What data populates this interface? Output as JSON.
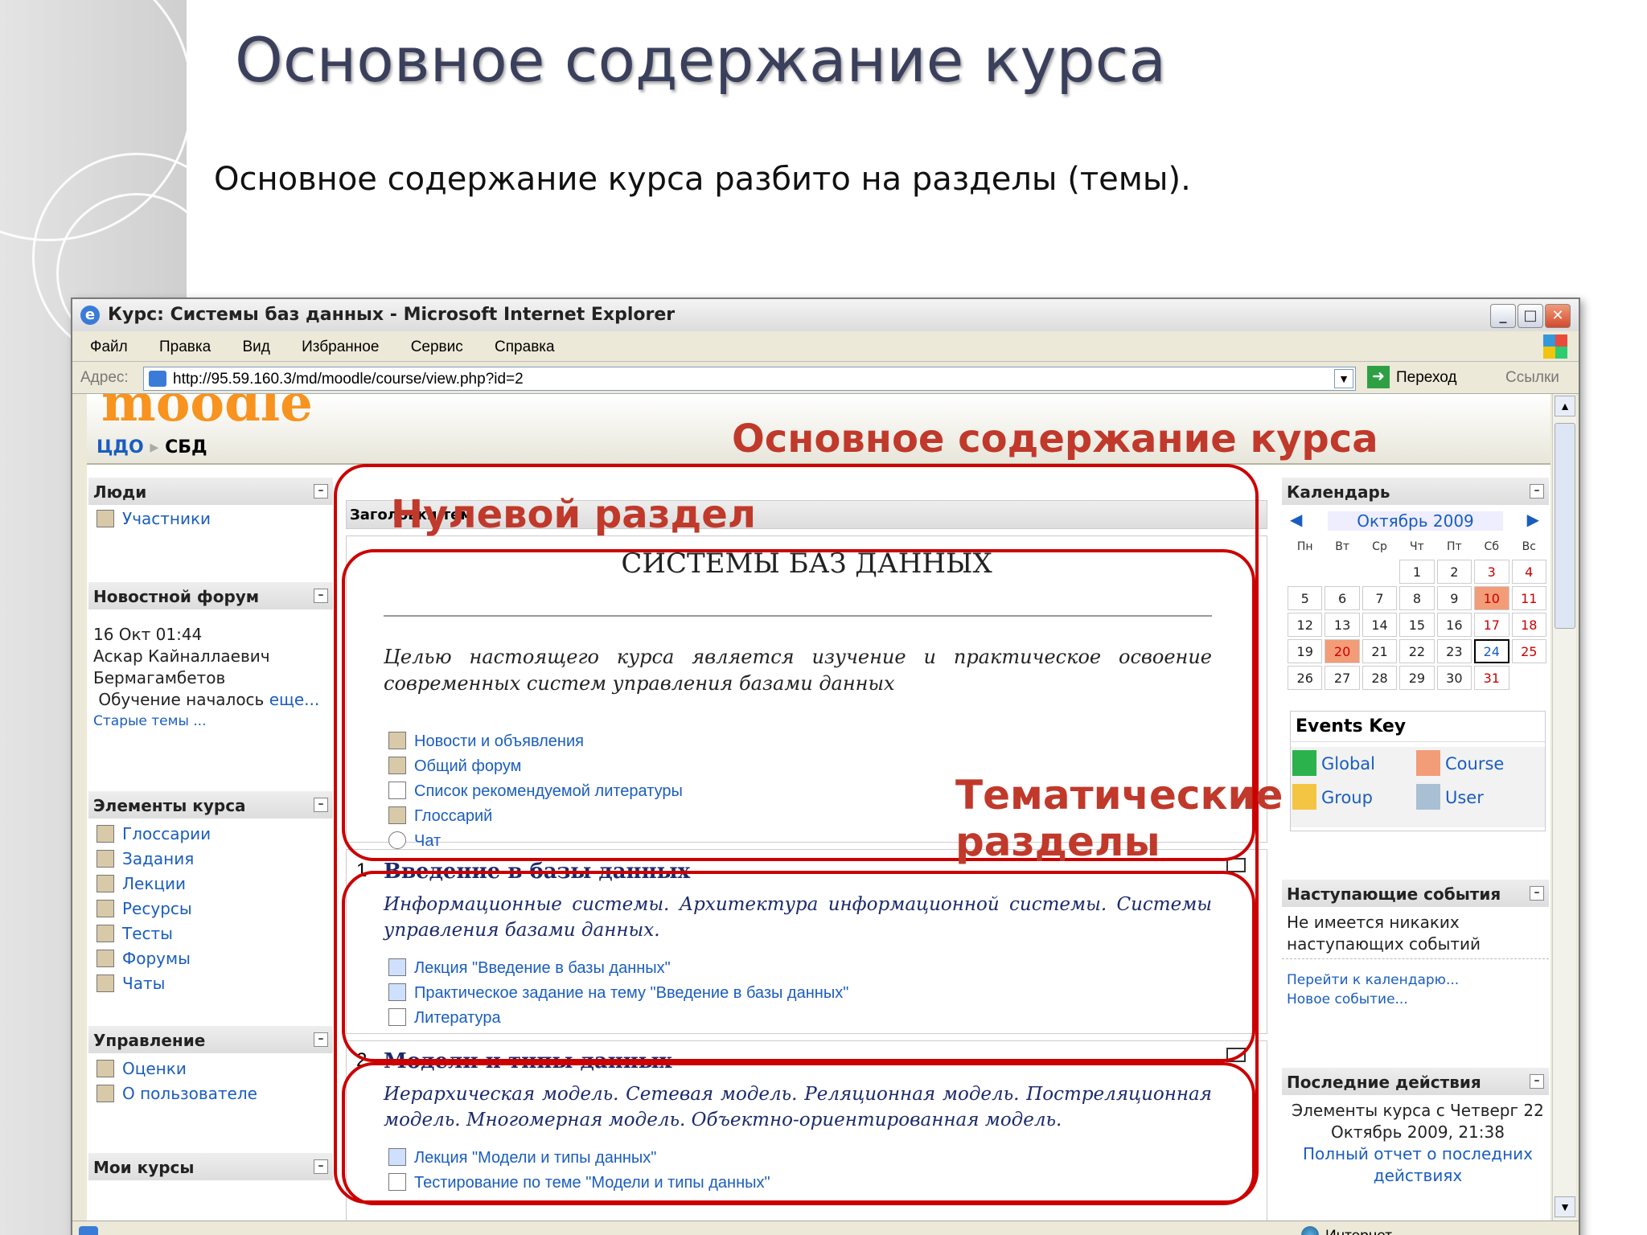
{
  "slide": {
    "title": "Основное содержание курса",
    "subtitle": "Основное содержание курса разбито на разделы (темы)."
  },
  "browser": {
    "title": "Курс: Системы баз данных - Microsoft Internet Explorer",
    "menu": [
      "Файл",
      "Правка",
      "Вид",
      "Избранное",
      "Сервис",
      "Справка"
    ],
    "address_label": "Адрес:",
    "url": "http://95.59.160.3/md/moodle/course/view.php?id=2",
    "go": "Переход",
    "links": "Ссылки",
    "status_zone": "Интернет"
  },
  "moodle": {
    "logo": "moodle",
    "crumb_home": "ЦДО",
    "crumb_course": "СБД"
  },
  "left": {
    "people": {
      "title": "Люди",
      "participants": "Участники"
    },
    "news": {
      "title": "Новостной форум",
      "date": "16 Окт 01:44",
      "author1": "Аскар Кайналлаевич",
      "author2": "Бермагамбетов",
      "msg": "Обучение началось",
      "more": "еще...",
      "old": "Старые темы ..."
    },
    "elements": {
      "title": "Элементы курса",
      "items": [
        "Глоссарии",
        "Задания",
        "Лекции",
        "Ресурсы",
        "Тесты",
        "Форумы",
        "Чаты"
      ]
    },
    "admin": {
      "title": "Управление",
      "items": [
        "Оценки",
        "О пользователе"
      ]
    },
    "my": {
      "title": "Мои курсы"
    }
  },
  "center": {
    "topic_header": "Заголовки тем",
    "course_title": "СИСТЕМЫ БАЗ ДАННЫХ",
    "course_desc": "Целью настоящего курса является изучение и практическое освоение современных систем управления базами данных",
    "zero_links": [
      "Новости и объявления",
      "Общий форум",
      "Список рекомендуемой литературы",
      "Глоссарий",
      "Чат"
    ],
    "s1": {
      "num": "1",
      "title": "Введение в базы данных",
      "desc": "Информационные системы. Архитектура информационной системы. Системы управления базами данных.",
      "links": [
        "Лекция \"Введение в базы данных\"",
        "Практическое задание на тему \"Введение в базы данных\"",
        "Литература"
      ]
    },
    "s2": {
      "num": "2",
      "title": "Модели и типы данных",
      "desc": "Иерархическая модель. Сетевая модель. Реляционная модель. Постреляционная модель. Многомерная модель. Объектно-ориентированная модель.",
      "links": [
        "Лекция \"Модели и типы данных\"",
        "Тестирование по теме \"Модели и типы данных\""
      ]
    }
  },
  "right": {
    "calendar": {
      "title": "Календарь",
      "month": "Октябрь 2009",
      "weekdays": [
        "Пн",
        "Вт",
        "Ср",
        "Чт",
        "Пт",
        "Сб",
        "Вс"
      ]
    },
    "events_key": {
      "title": "Events Key",
      "global": "Global",
      "course": "Course",
      "group": "Group",
      "user": "User"
    },
    "upcoming": {
      "title": "Наступающие события",
      "none1": "Не имеется никаких",
      "none2": "наступающих событий",
      "goto": "Перейти к календарю...",
      "new": "Новое событие..."
    },
    "recent": {
      "title": "Последние действия",
      "l1": "Элементы курса с Четверг 22",
      "l2": "Октябрь 2009, 21:38",
      "l3": "Полный отчет о последних",
      "l4": "действиях"
    }
  },
  "annotations": {
    "main": "Основное содержание курса",
    "zero": "Нулевой раздел",
    "thematic1": "Тематические",
    "thematic2": "разделы"
  }
}
